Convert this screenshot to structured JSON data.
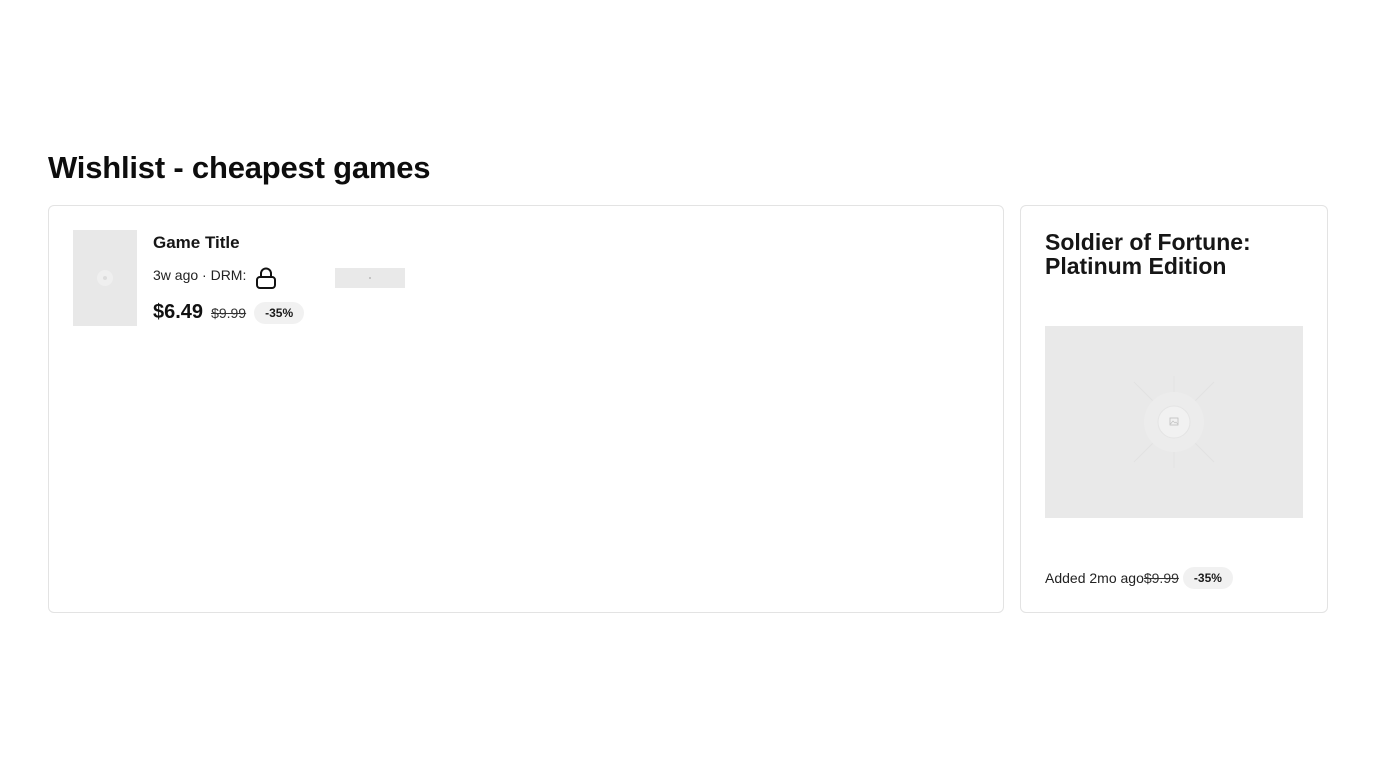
{
  "page": {
    "title": "Wishlist - cheapest games"
  },
  "game": {
    "title": "Game Title",
    "meta": "3w ago · DRM:",
    "drm_icon": "lock-icon",
    "price": "$6.49",
    "old_price": "$9.99",
    "discount": "-35%"
  },
  "featured": {
    "title": "Soldier of Fortune: Platinum Edition",
    "image_icon": "image-placeholder-icon",
    "added": "Added 2mo ago",
    "old_price": "$9.99",
    "discount": "-35%"
  }
}
